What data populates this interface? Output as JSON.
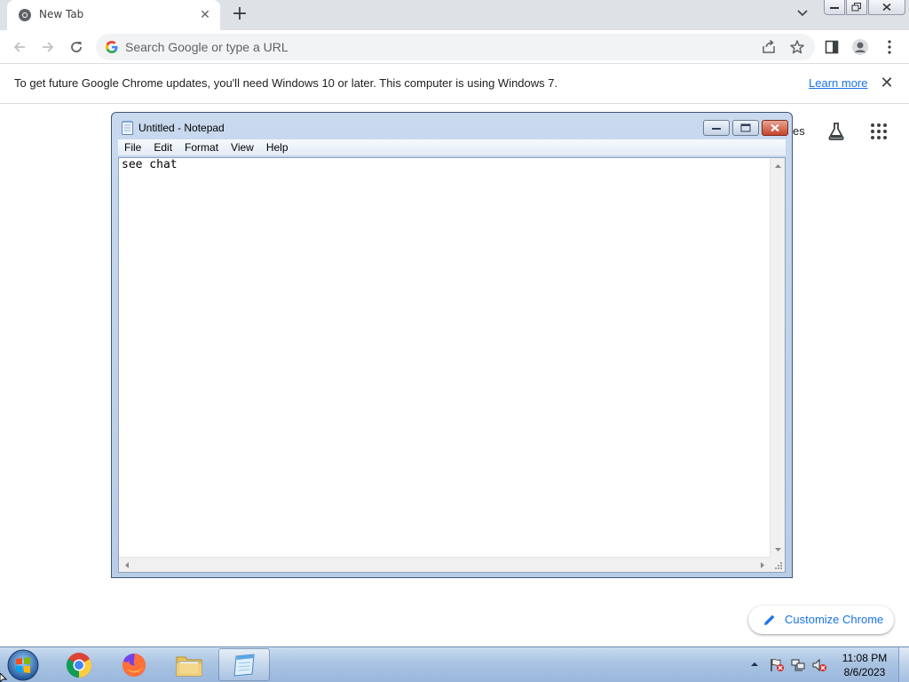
{
  "browser": {
    "tab": {
      "title": "New Tab",
      "favicon": "chrome-icon"
    },
    "omnibox": {
      "placeholder": "Search Google or type a URL"
    },
    "infobar": {
      "message": "To get future Google Chrome updates, you'll need Windows 10 or later. This computer is using Windows 7.",
      "link": "Learn more"
    },
    "ntp": {
      "partial_link": "es",
      "customize_label": "Customize Chrome",
      "accent": "#1a73e8"
    }
  },
  "notepad": {
    "title": "Untitled - Notepad",
    "menu": [
      "File",
      "Edit",
      "Format",
      "View",
      "Help"
    ],
    "content": "see chat"
  },
  "taskbar": {
    "apps": [
      "chrome-icon",
      "firefox-icon",
      "file-explorer-icon",
      "notepad-icon"
    ],
    "active_app": "notepad-icon",
    "clock": {
      "time": "11:08 PM",
      "date": "8/6/2023"
    }
  }
}
